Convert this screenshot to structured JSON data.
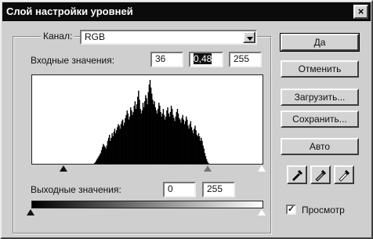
{
  "window": {
    "title": "Слой настройки уровней",
    "close_label": "×"
  },
  "channel": {
    "label": "Канал:",
    "value": "RGB"
  },
  "input": {
    "label": "Входные значения:",
    "black": "36",
    "gamma": "0,48",
    "white": "255"
  },
  "output": {
    "label": "Выходные значения:",
    "black": "0",
    "white": "255"
  },
  "buttons": {
    "ok": "Да",
    "cancel": "Отменить",
    "load": "Загрузить...",
    "save": "Сохранить...",
    "auto": "Авто"
  },
  "eyedroppers": [
    "black-eyedropper-icon",
    "gray-eyedropper-icon",
    "white-eyedropper-icon"
  ],
  "preview": {
    "label": "Просмотр",
    "checked": true,
    "mark": "✓"
  },
  "histogram": [
    0,
    0,
    0,
    0,
    0,
    0,
    0,
    0,
    0,
    0,
    0,
    0,
    0,
    0,
    0,
    0,
    0,
    0,
    0,
    0,
    0,
    0,
    0,
    0,
    0,
    0,
    0,
    0,
    0,
    0,
    0,
    0,
    0,
    0,
    0,
    0,
    0,
    0,
    0,
    0,
    0,
    0,
    0,
    0,
    0,
    0,
    0,
    0,
    0,
    0,
    0,
    0,
    0,
    0,
    0,
    0,
    0,
    0,
    0,
    0,
    0,
    0,
    0,
    0,
    0,
    0,
    0,
    0,
    0,
    0,
    1,
    2,
    4,
    6,
    8,
    10,
    12,
    14,
    18,
    22,
    26,
    24,
    22,
    20,
    24,
    30,
    34,
    38,
    30,
    34,
    40,
    36,
    42,
    46,
    40,
    44,
    48,
    52,
    50,
    46,
    52,
    56,
    58,
    50,
    54,
    60,
    64,
    70,
    66,
    58,
    62,
    74,
    70,
    64,
    68,
    76,
    82,
    72,
    78,
    88,
    96,
    84,
    72,
    66,
    70,
    80,
    74,
    82,
    90,
    86,
    78,
    94,
    104,
    110,
    100,
    92,
    84,
    78,
    82,
    74,
    70,
    66,
    72,
    80,
    76,
    68,
    62,
    66,
    72,
    64,
    58,
    62,
    70,
    74,
    66,
    62,
    68,
    76,
    72,
    64,
    60,
    56,
    62,
    68,
    72,
    66,
    60,
    58,
    54,
    60,
    64,
    58,
    52,
    56,
    62,
    58,
    50,
    46,
    52,
    56,
    48,
    44,
    40,
    46,
    50,
    44,
    38,
    36,
    40,
    36,
    30,
    34,
    30,
    24,
    20,
    14,
    10,
    6,
    3,
    1,
    0,
    0,
    0,
    0,
    0,
    0,
    0,
    0,
    0,
    0,
    0,
    0,
    0,
    0,
    0,
    0,
    0,
    0,
    0,
    0,
    0,
    0,
    0,
    0,
    0,
    0,
    0,
    0,
    0,
    0,
    0,
    0,
    0,
    0,
    0,
    0,
    0,
    0,
    0,
    0,
    0,
    0,
    0,
    0,
    0,
    0,
    0,
    0,
    0,
    0,
    0,
    0,
    0,
    0,
    0,
    0,
    0,
    0,
    0,
    0,
    0
  ]
}
